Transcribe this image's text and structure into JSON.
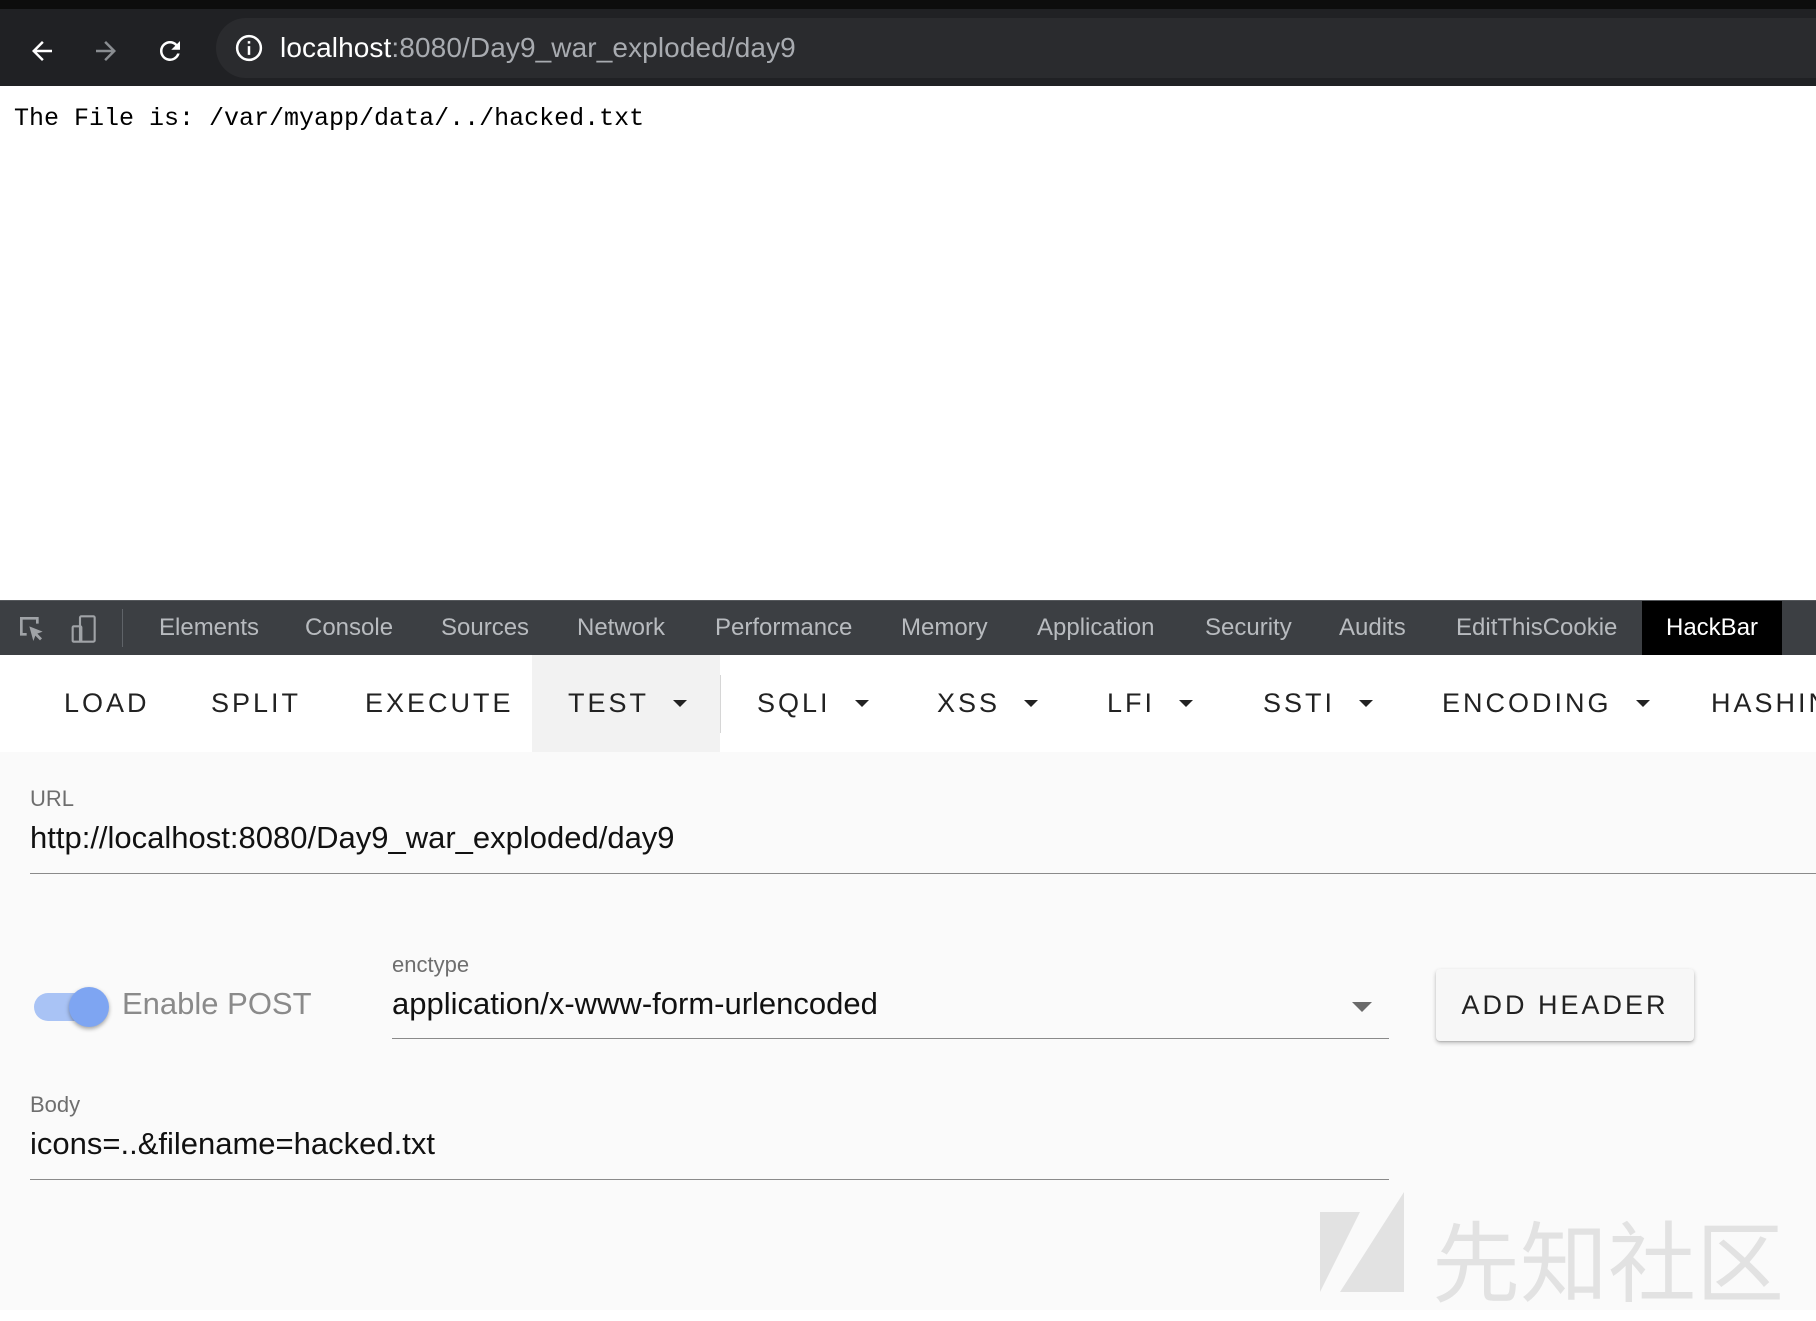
{
  "browser": {
    "url_host": "localhost",
    "url_path": ":8080/Day9_war_exploded/day9"
  },
  "page": {
    "text": "The File is: /var/myapp/data/../hacked.txt"
  },
  "devtools": {
    "tabs": [
      {
        "label": "Elements"
      },
      {
        "label": "Console"
      },
      {
        "label": "Sources"
      },
      {
        "label": "Network"
      },
      {
        "label": "Performance"
      },
      {
        "label": "Memory"
      },
      {
        "label": "Application"
      },
      {
        "label": "Security"
      },
      {
        "label": "Audits"
      },
      {
        "label": "EditThisCookie"
      },
      {
        "label": "HackBar"
      }
    ],
    "active_tab": "HackBar"
  },
  "hackbar": {
    "toolbar": {
      "load": "LOAD",
      "split": "SPLIT",
      "execute": "EXECUTE",
      "test": "TEST",
      "sqli": "SQLI",
      "xss": "XSS",
      "lfi": "LFI",
      "ssti": "SSTI",
      "encoding": "ENCODING",
      "hashing": "HASHIN"
    },
    "url": {
      "label": "URL",
      "value": "http://localhost:8080/Day9_war_exploded/day9"
    },
    "enable_post": {
      "label": "Enable POST",
      "checked": true
    },
    "enctype": {
      "label": "enctype",
      "value": "application/x-www-form-urlencoded"
    },
    "add_header": "ADD HEADER",
    "body": {
      "label": "Body",
      "value": "icons=..&filename=hacked.txt"
    }
  },
  "watermark": {
    "text": "先知社区"
  },
  "colors": {
    "chrome_bg": "#202124",
    "devtools_bg": "#3c3f43",
    "active_tab_bg": "#000000",
    "toggle_accent": "#7ea5f2",
    "panel_bg": "#fafafa"
  }
}
